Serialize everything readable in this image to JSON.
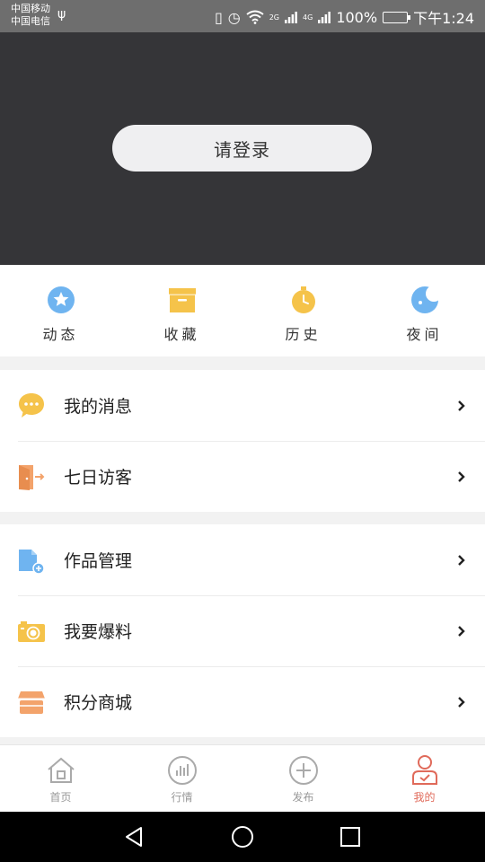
{
  "statusbar": {
    "carrier1": "中国移动",
    "carrier2": "中国电信",
    "net1": "2G",
    "net2": "4G",
    "battery": "100%",
    "time": "下午1:24"
  },
  "header": {
    "login": "请登录"
  },
  "quicknav": [
    {
      "label": "动态",
      "icon": "star-icon",
      "color": "#6fb4f0"
    },
    {
      "label": "收藏",
      "icon": "archive-box-icon",
      "color": "#f5c34a"
    },
    {
      "label": "历史",
      "icon": "stopwatch-icon",
      "color": "#f5c34a"
    },
    {
      "label": "夜间",
      "icon": "moon-icon",
      "color": "#6fb4f0"
    }
  ],
  "menu": {
    "group1": [
      {
        "label": "我的消息",
        "icon": "message-bubble-icon"
      },
      {
        "label": "七日访客",
        "icon": "door-exit-icon"
      }
    ],
    "group2": [
      {
        "label": "作品管理",
        "icon": "document-add-icon"
      },
      {
        "label": "我要爆料",
        "icon": "camera-icon"
      },
      {
        "label": "积分商城",
        "icon": "shop-icon"
      }
    ]
  },
  "tabbar": [
    {
      "label": "首页",
      "icon": "home-icon"
    },
    {
      "label": "行情",
      "icon": "chart-icon"
    },
    {
      "label": "发布",
      "icon": "plus-circle-icon"
    },
    {
      "label": "我的",
      "icon": "user-icon",
      "active": true
    }
  ],
  "colors": {
    "accent": "#e06a5a",
    "header_bg": "#353538",
    "yellow": "#f5c34a",
    "blue": "#6fb4f0",
    "orange": "#f3a36b"
  }
}
